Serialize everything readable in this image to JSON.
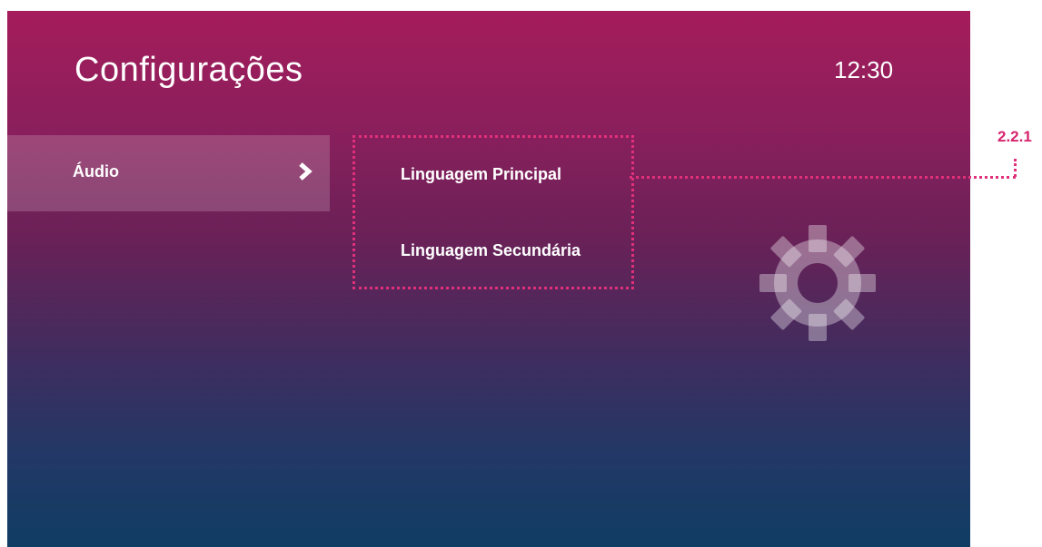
{
  "screen": {
    "title": "Configurações",
    "clock": "12:30"
  },
  "menu": {
    "active_item": {
      "label": "Áudio",
      "chevron_icon": "chevron-right-icon"
    }
  },
  "submenu": {
    "items": [
      {
        "label": "Linguagem Principal"
      },
      {
        "label": "Linguagem Secundária"
      }
    ]
  },
  "decor": {
    "gear_icon": "gear-icon"
  },
  "annotation": {
    "label": "2.2.1",
    "color": "#d6246e"
  },
  "colors": {
    "highlight_border": "#e0307a",
    "gradient_top": "#a51c5b",
    "gradient_bottom": "#0f3d63",
    "text": "#ffffff"
  }
}
